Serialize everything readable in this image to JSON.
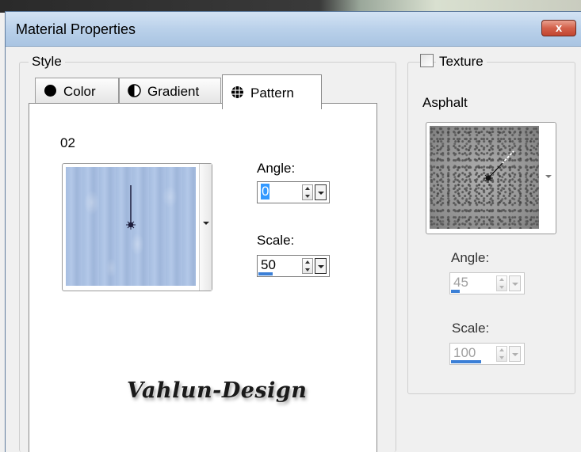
{
  "window": {
    "title": "Material Properties",
    "close_label": "x"
  },
  "style_group": {
    "legend": "Style",
    "tabs": [
      {
        "label": "Color",
        "icon": "filled-circle-icon",
        "active": false
      },
      {
        "label": "Gradient",
        "icon": "half-circle-icon",
        "active": false
      },
      {
        "label": "Pattern",
        "icon": "pattern-globe-icon",
        "active": true
      }
    ],
    "pattern": {
      "name": "02",
      "angle_label": "Angle:",
      "angle_value": "0",
      "scale_label": "Scale:",
      "scale_value": "50",
      "scale_fraction": 0.2,
      "swatch_color": "#a9bfe2"
    }
  },
  "texture_group": {
    "checkbox_label": "Texture",
    "checked": false,
    "name": "Asphalt",
    "angle_label": "Angle:",
    "angle_value": "45",
    "angle_fraction": 0.125,
    "scale_label": "Scale:",
    "scale_value": "100",
    "scale_fraction": 0.42
  },
  "watermark": "Vahlun-Design"
}
